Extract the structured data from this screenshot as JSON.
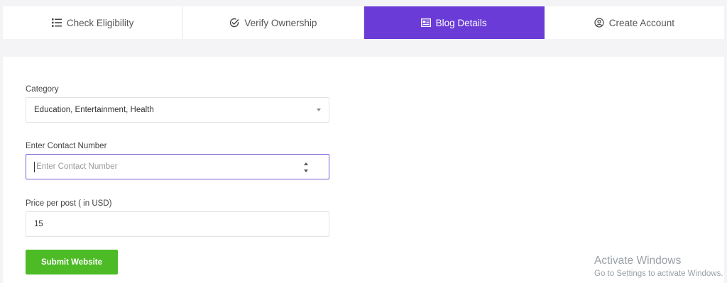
{
  "tabs": [
    {
      "label": "Check Eligibility",
      "icon": "list-icon"
    },
    {
      "label": "Verify Ownership",
      "icon": "check-circle-icon"
    },
    {
      "label": "Blog Details",
      "icon": "window-icon"
    },
    {
      "label": "Create Account",
      "icon": "user-circle-icon"
    }
  ],
  "active_tab": "Blog Details",
  "form": {
    "category": {
      "label": "Category",
      "value": "Education, Entertainment, Health"
    },
    "contact": {
      "label": "Enter Contact Number",
      "placeholder": "Enter Contact Number",
      "value": ""
    },
    "price": {
      "label": "Price per post ( in USD)",
      "value": "15"
    },
    "submit_label": "Submit Website"
  },
  "watermark": {
    "title": "Activate Windows",
    "subtitle": "Go to Settings to activate Windows."
  },
  "colors": {
    "accent": "#6a3bd6",
    "submit": "#4cbb25"
  }
}
